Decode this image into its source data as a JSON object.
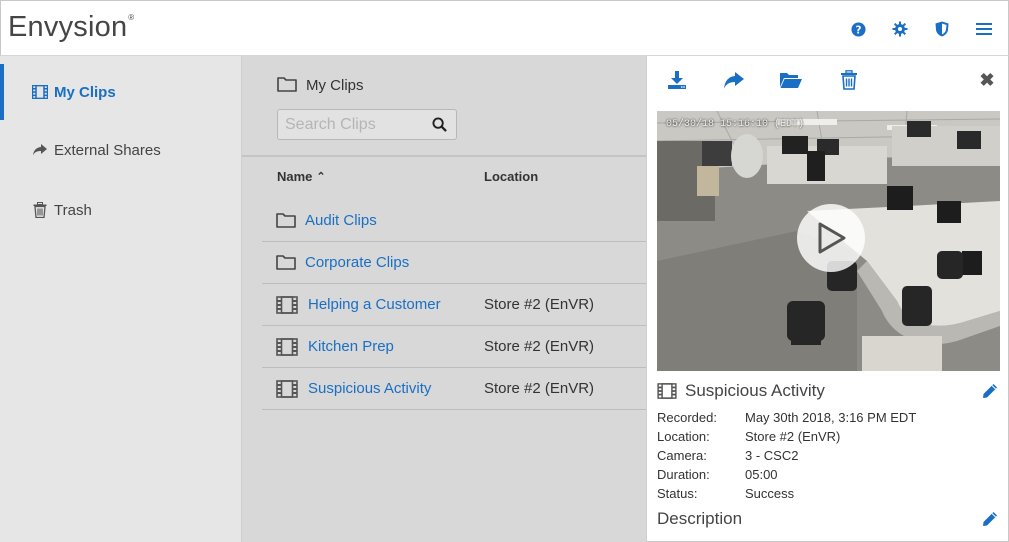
{
  "app": {
    "logo": "Envysion",
    "logo_mark": "®"
  },
  "header_icons": [
    "help-icon",
    "gear-icon",
    "shield-icon",
    "menu-icon"
  ],
  "colors": {
    "accent": "#1a6fc4",
    "sidebar_bg": "#e6e6e6",
    "main_bg": "#d8d8d8"
  },
  "sidebar": {
    "items": [
      {
        "label": "My Clips",
        "icon": "film-icon",
        "active": true
      },
      {
        "label": "External Shares",
        "icon": "share-icon",
        "active": false
      },
      {
        "label": "Trash",
        "icon": "trash-icon",
        "active": false
      }
    ]
  },
  "main": {
    "breadcrumb": "My Clips",
    "search_placeholder": "Search Clips",
    "columns": {
      "name": "Name",
      "name_sort": "⌃",
      "location": "Location"
    },
    "rows": [
      {
        "type": "folder",
        "name": "Audit Clips",
        "location": ""
      },
      {
        "type": "folder",
        "name": "Corporate Clips",
        "location": ""
      },
      {
        "type": "clip",
        "name": "Helping a Customer",
        "location": "Store #2 (EnVR)"
      },
      {
        "type": "clip",
        "name": "Kitchen Prep",
        "location": "Store #2 (EnVR)"
      },
      {
        "type": "clip",
        "name": "Suspicious Activity",
        "location": "Store #2 (EnVR)"
      }
    ]
  },
  "panel": {
    "tools": [
      "download-icon",
      "share-icon",
      "folder-open-icon",
      "trash-icon"
    ],
    "close": "✖",
    "video_timestamp": "05/30/18 15:16:10 (EDT)",
    "title": "Suspicious Activity",
    "meta": {
      "recorded_label": "Recorded:",
      "recorded": "May 30th 2018, 3:16 PM EDT",
      "location_label": "Location:",
      "location": "Store #2 (EnVR)",
      "camera_label": "Camera:",
      "camera": "3 - CSC2",
      "duration_label": "Duration:",
      "duration": "05:00",
      "status_label": "Status:",
      "status": "Success"
    },
    "description_heading": "Description"
  }
}
